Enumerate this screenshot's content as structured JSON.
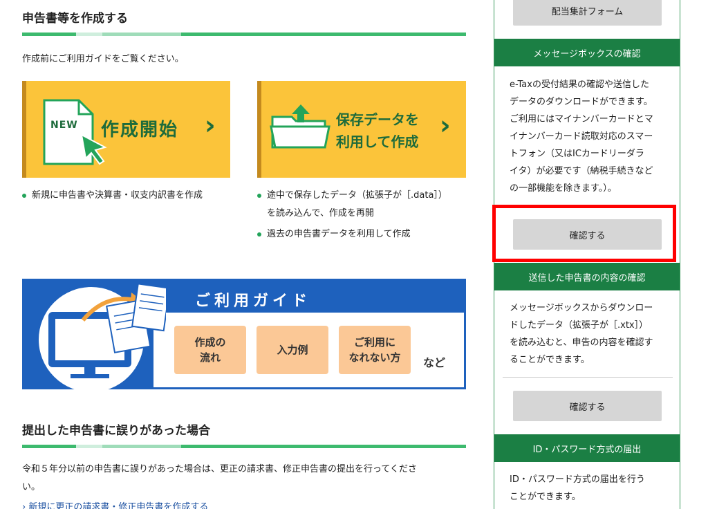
{
  "main": {
    "section1": {
      "title": "申告書等を作成する",
      "intro": "作成前にご利用ガイドをご覧ください。"
    },
    "cards": [
      {
        "badge": "NEW",
        "label": "作成開始",
        "chevron": "›",
        "icon": "new-document-icon"
      },
      {
        "label_line1": "保存データを",
        "label_line2": "利用して作成",
        "chevron": "›",
        "icon": "folder-upload-icon"
      }
    ],
    "bullets_left": [
      "新規に申告書や決算書・収支内訳書を作成"
    ],
    "bullets_right": [
      {
        "line1": "途中で保存したデータ（拡張子が［.data］）",
        "line2": "を読み込んで、作成を再開"
      },
      {
        "line1": "過去の申告書データを利用して作成"
      }
    ],
    "guide": {
      "title": "ご利用ガイド",
      "btn1_line1": "作成の",
      "btn1_line2": "流れ",
      "btn2": "入力例",
      "btn3_line1": "ご利用に",
      "btn3_line2": "なれない方",
      "etc": "など"
    },
    "section2": {
      "title": "提出した申告書に誤りがあった場合",
      "intro_line1": "令和５年分以前の申告書に誤りがあった場合は、更正の請求書、修正申告書の提出を行ってくださ",
      "intro_line2": "い。",
      "link": "新規に更正の請求書・修正申告書を作成する"
    }
  },
  "sidebar": {
    "dividend_button": "配当集計フォーム",
    "msgbox": {
      "header": "メッセージボックスの確認",
      "lines": [
        "e-Taxの受付結果の確認や送信した",
        "データのダウンロードができます。",
        "ご利用にはマイナンバーカードとマ",
        "イナンバーカード読取対応のスマー",
        "トフォン（又はICカードリーダラ",
        "イタ）が必要です（納税手続きなど",
        "の一部機能を除きます。）。"
      ],
      "button": "確認する"
    },
    "sent": {
      "header": "送信した申告書の内容の確認",
      "lines": [
        "メッセージボックスからダウンロー",
        "ドしたデータ（拡張子が［.xtx］）",
        "を読み込むと、申告の内容を確認す",
        "ることができます。"
      ],
      "button": "確認する"
    },
    "idpw": {
      "header": "ID・パスワード方式の届出",
      "lines": [
        "ID・パスワード方式の届出を行う",
        "ことができます。"
      ]
    }
  },
  "colors": {
    "accent_green": "#3dba6e",
    "dark_green": "#1b7f44",
    "card_yellow": "#fbc43a",
    "guide_blue": "#1e61bd",
    "highlight_red": "#ff0000"
  }
}
